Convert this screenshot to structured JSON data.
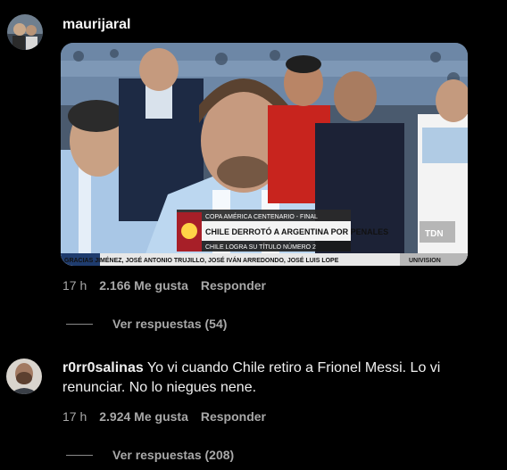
{
  "comments": [
    {
      "username": "maurijaral",
      "text": "",
      "media": {
        "graphic_title": "COPA AMÉRICA CENTENARIO - FINAL",
        "headline": "CHILE DERROTÓ A ARGENTINA POR PENALES",
        "subheadline": "CHILE LOGRA SU TÍTULO NÚMERO 2",
        "ticker": "GRACIAS   JIMÉNEZ, JOSÉ ANTONIO TRUJILLO, JOSÉ IVÁN ARREDONDO, JOSÉ LUIS LOPE",
        "network_logo": "UNIVISION",
        "channel_logo": "TDN"
      },
      "time": "17 h",
      "likes": "2.166 Me gusta",
      "reply_label": "Responder",
      "view_replies": "Ver respuestas (54)"
    },
    {
      "username": "r0rr0salinas",
      "text": "Yo vi cuando Chile retiro a Frionel Messi. Lo vi renunciar. No lo niegues nene.",
      "time": "17 h",
      "likes": "2.924 Me gusta",
      "reply_label": "Responder",
      "view_replies": "Ver respuestas (208)"
    }
  ],
  "colors": {
    "background": "#000000",
    "text": "#f5f5f5",
    "muted": "#a8a8a8"
  }
}
